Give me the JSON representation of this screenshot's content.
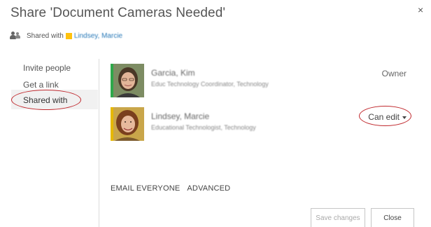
{
  "dialog": {
    "title": "Share 'Document Cameras Needed'",
    "close_glyph": "×"
  },
  "shared_with": {
    "icon": "people-icon",
    "label": "Shared with",
    "names": "Lindsey, Marcie",
    "accent_color": "#ffc20e"
  },
  "nav": {
    "items": [
      {
        "label": "Invite people"
      },
      {
        "label": "Get a link"
      },
      {
        "label": "Shared with"
      }
    ],
    "selected": "Shared with",
    "highlight_color": "#c0282d"
  },
  "people": [
    {
      "name": "Garcia, Kim",
      "subtitle": "Educ Technology Coordinator, Technology",
      "role": "Owner"
    },
    {
      "name": "Lindsey, Marcie",
      "subtitle": "Educational Technologist, Technology",
      "role": "Can edit"
    }
  ],
  "actions": {
    "email_everyone": "EMAIL EVERYONE",
    "advanced": "ADVANCED"
  },
  "buttons": {
    "save": "Save changes",
    "close": "Close"
  }
}
